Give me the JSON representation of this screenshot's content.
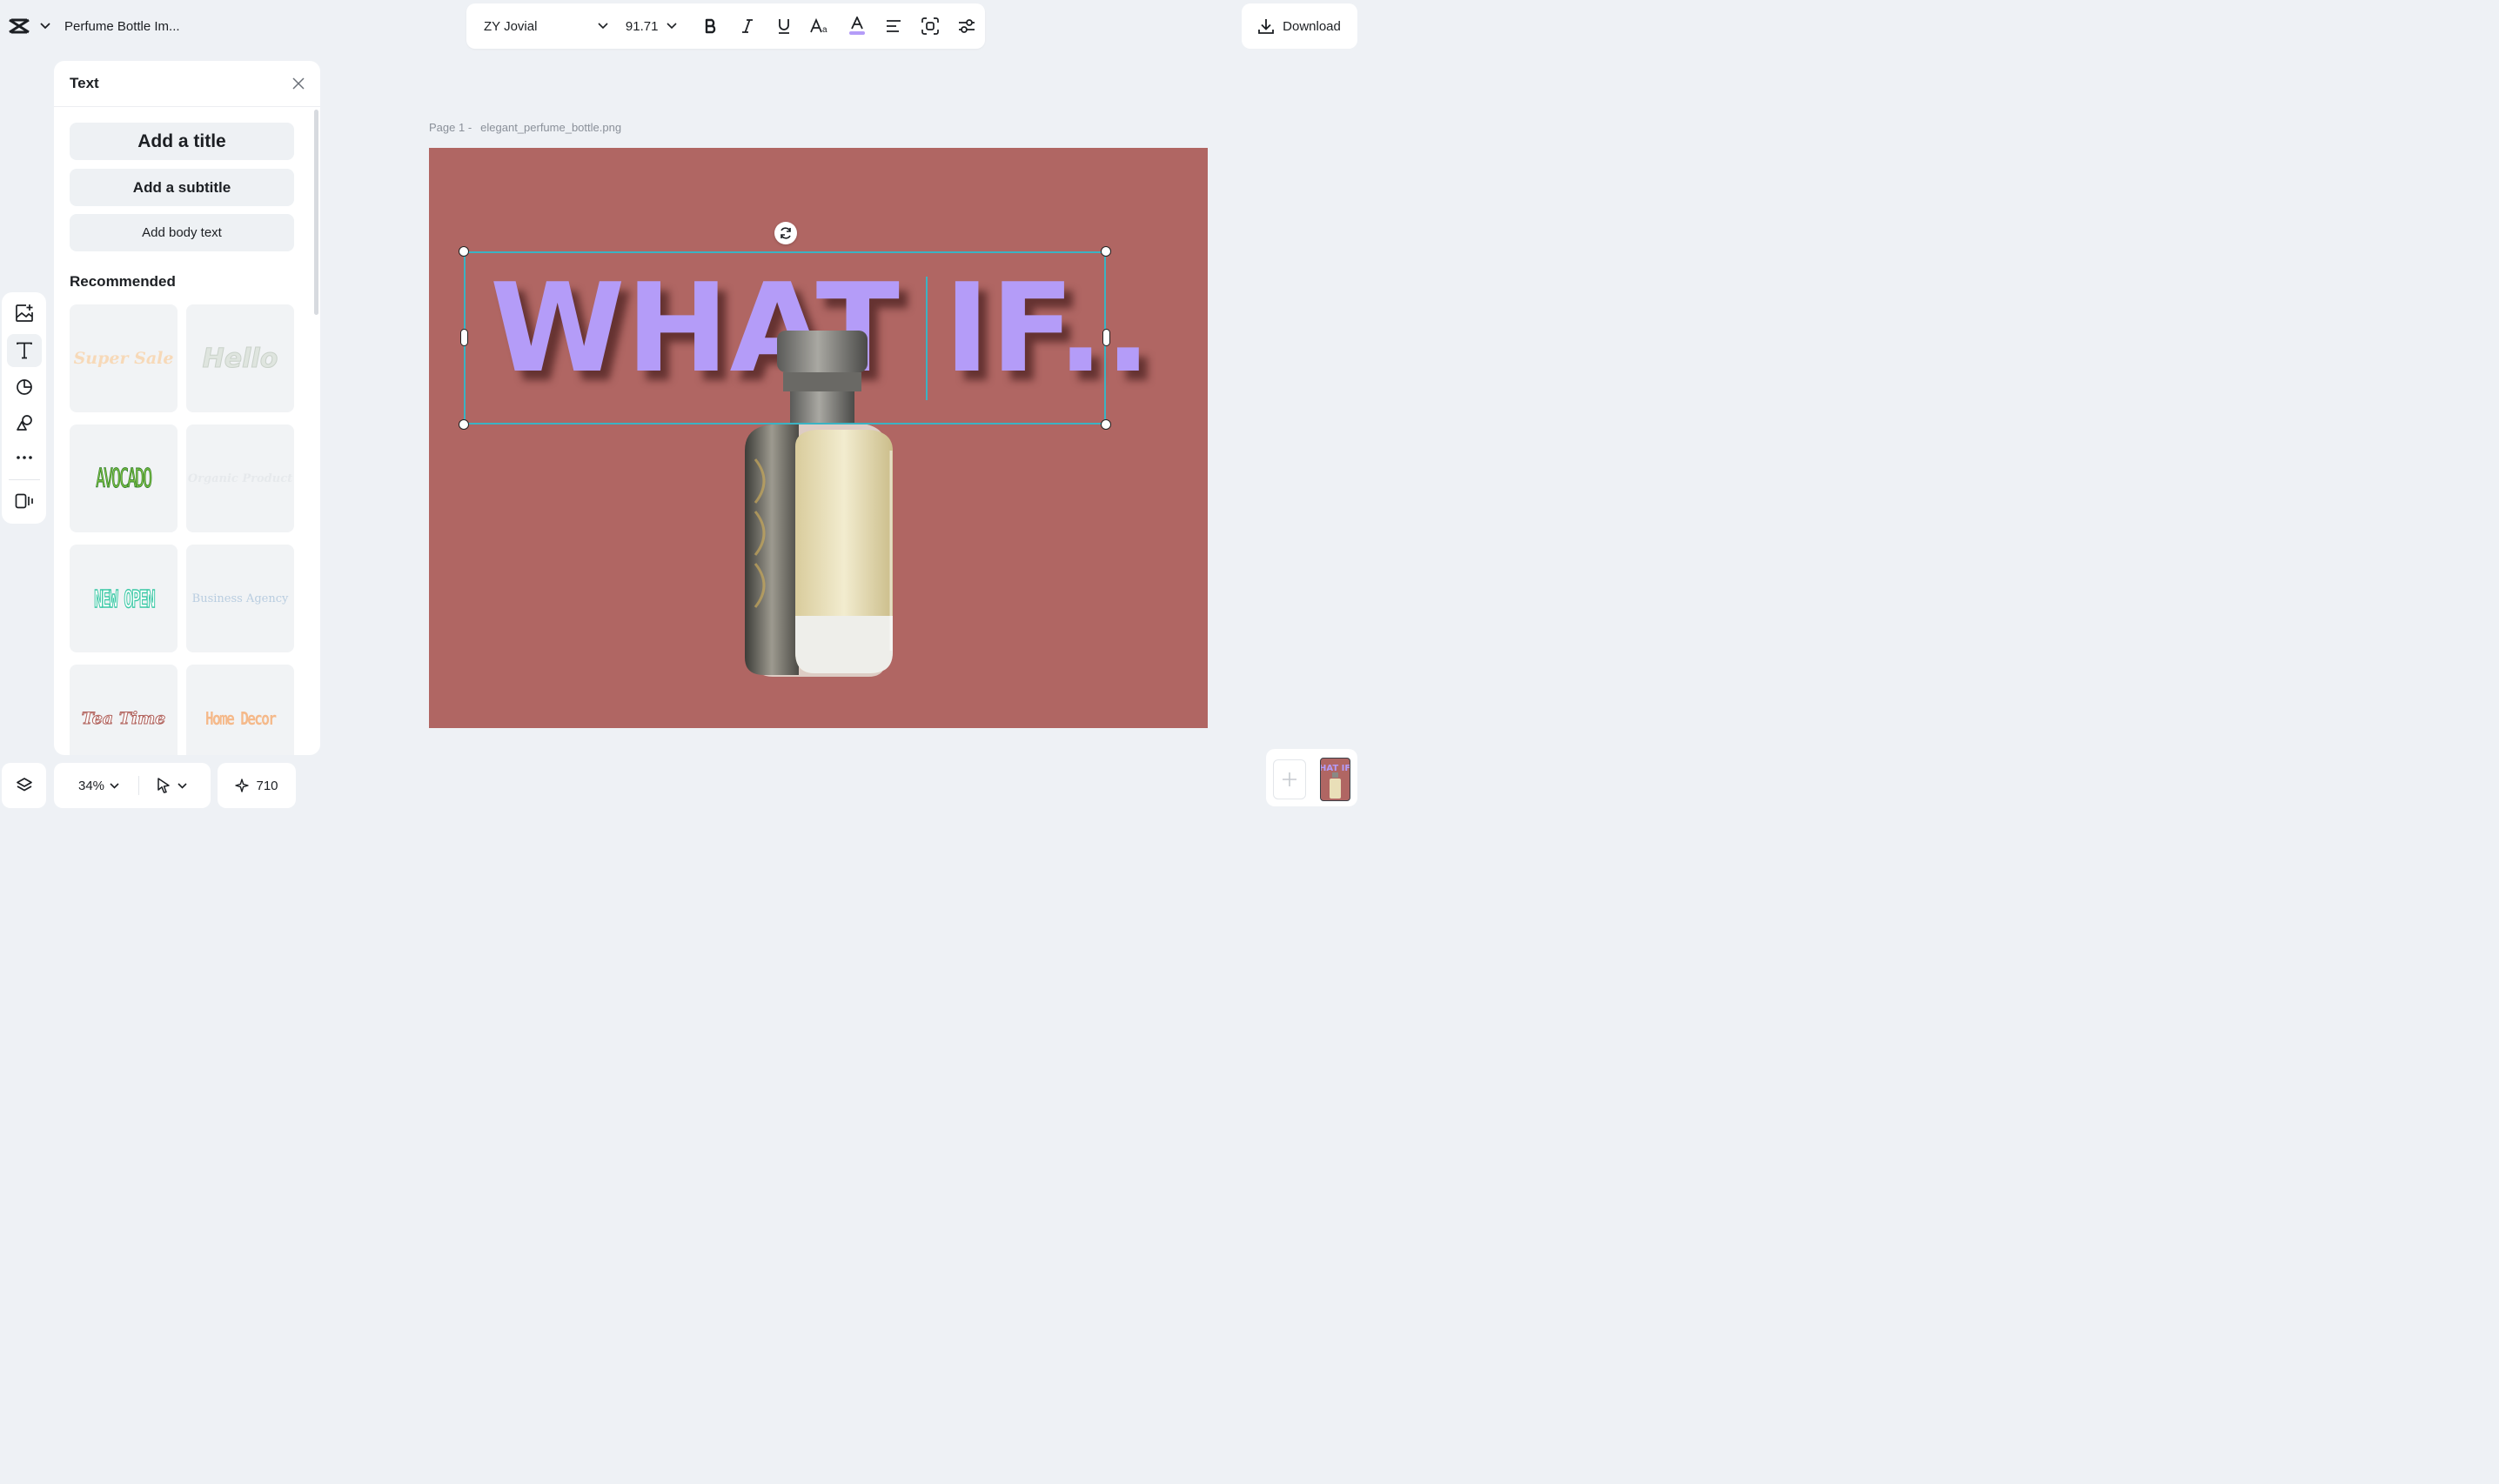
{
  "project": {
    "title": "Perfume Bottle Im..."
  },
  "toolbar": {
    "font_family": "ZY Jovial",
    "font_size": "91.71",
    "tools": [
      "bold-icon",
      "italic-icon",
      "underline-icon",
      "font-case-icon",
      "text-color-icon",
      "align-left-icon",
      "effect-icon",
      "adjust-icon"
    ],
    "text_color": "#b49cf8"
  },
  "download": {
    "label": "Download"
  },
  "panel": {
    "title": "Text",
    "add_title": "Add a title",
    "add_subtitle": "Add a subtitle",
    "add_body": "Add body text",
    "recommended_heading": "Recommended",
    "recommended": [
      {
        "text": "Super Sale",
        "color": "#f7d9b8"
      },
      {
        "text": "Hello",
        "color": "#dfe5df"
      },
      {
        "text": "AVOCADO",
        "color": "#7fc243"
      },
      {
        "text": "Organic Product",
        "color": "#e6e9ec"
      },
      {
        "text": "NEW OPEN",
        "color": "#5fd6b8"
      },
      {
        "text": "Business Agency",
        "color": "#b9cde0"
      },
      {
        "text": "Tea Time",
        "color": "#c9857f"
      },
      {
        "text": "Home Decor",
        "color": "#f5b98a"
      }
    ]
  },
  "bottom": {
    "zoom": "34%",
    "credits": "710"
  },
  "canvas": {
    "page_label": "Page 1 -",
    "file_name": "elegant_perfume_bottle.png",
    "background": "#b06663",
    "headline": "WHAT IF..",
    "thumb_text": "HAT IF"
  }
}
